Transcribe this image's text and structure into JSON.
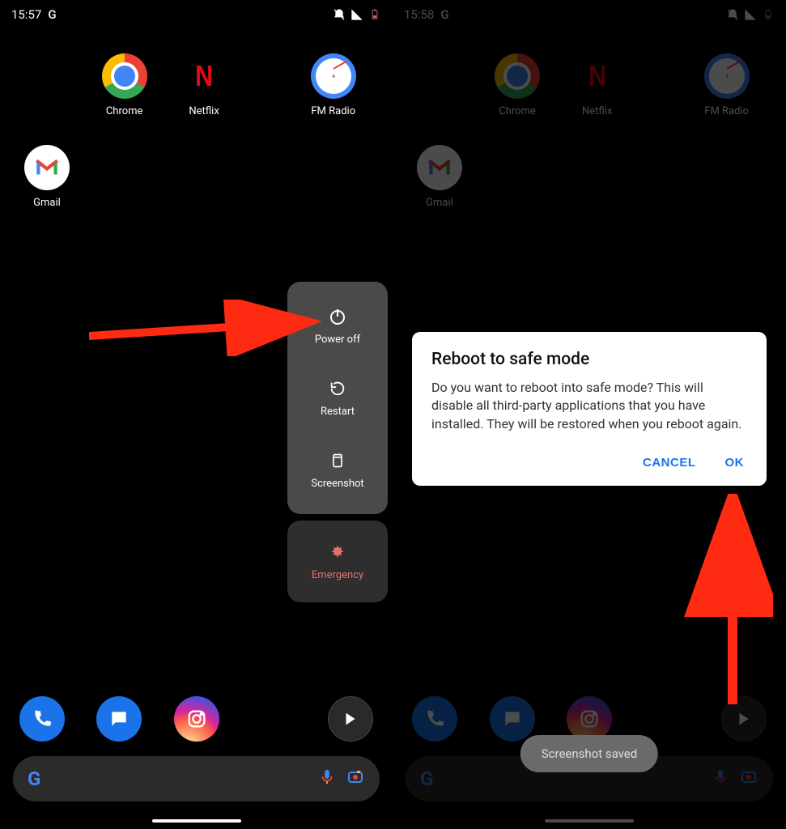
{
  "left": {
    "status": {
      "time": "15:57",
      "g": "G"
    },
    "apps": {
      "chrome": "Chrome",
      "netflix": "Netflix",
      "fmradio": "FM Radio",
      "gmail": "Gmail"
    },
    "power_menu": {
      "power_off": "Power off",
      "restart": "Restart",
      "screenshot": "Screenshot",
      "emergency": "Emergency"
    }
  },
  "right": {
    "status": {
      "time": "15:58",
      "g": "G"
    },
    "apps": {
      "chrome": "Chrome",
      "netflix": "Netflix",
      "fmradio": "FM Radio",
      "gmail": "Gmail"
    },
    "dialog": {
      "title": "Reboot to safe mode",
      "body": "Do you want to reboot into safe mode? This will disable all third-party applications that you have installed. They will be restored when you reboot again.",
      "cancel": "CANCEL",
      "ok": "OK"
    },
    "toast": "Screenshot saved"
  },
  "colors": {
    "arrow": "#ff2a12",
    "accent": "#1a73e8"
  }
}
